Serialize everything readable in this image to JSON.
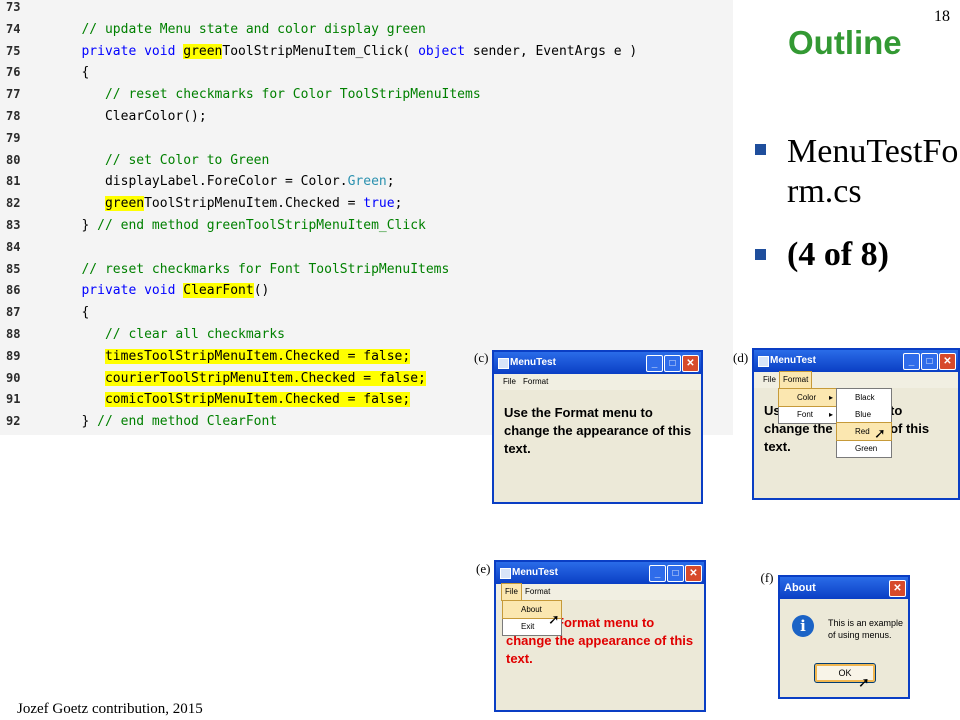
{
  "slide_number": "18",
  "outline_title": "Outline",
  "bullets": [
    "MenuTestForm.cs",
    "(4 of 8)"
  ],
  "footer": "Jozef Goetz contribution, 2015",
  "code_lines": [
    {
      "num": "73",
      "parts": []
    },
    {
      "num": "74",
      "parts": [
        {
          "t": "   "
        },
        {
          "t": "// update Menu state and color display green",
          "c": "cm"
        }
      ]
    },
    {
      "num": "75",
      "parts": [
        {
          "t": "   "
        },
        {
          "t": "private",
          "c": "kw"
        },
        {
          "t": " "
        },
        {
          "t": "void",
          "c": "kw"
        },
        {
          "t": " "
        },
        {
          "t": "green",
          "c": "hl"
        },
        {
          "t": "ToolStripMenuItem_Click( "
        },
        {
          "t": "object",
          "c": "kw"
        },
        {
          "t": " sender, EventArgs e )"
        }
      ]
    },
    {
      "num": "76",
      "parts": [
        {
          "t": "   {"
        }
      ]
    },
    {
      "num": "77",
      "parts": [
        {
          "t": "      "
        },
        {
          "t": "// reset checkmarks for Color ToolStripMenuItems",
          "c": "cm"
        }
      ]
    },
    {
      "num": "78",
      "parts": [
        {
          "t": "      ClearColor();"
        }
      ]
    },
    {
      "num": "79",
      "parts": []
    },
    {
      "num": "80",
      "parts": [
        {
          "t": "      "
        },
        {
          "t": "// set Color to Green",
          "c": "cm"
        }
      ]
    },
    {
      "num": "81",
      "parts": [
        {
          "t": "      displayLabel.ForeColor = Color."
        },
        {
          "t": "Green",
          "c": "ty"
        },
        {
          "t": ";"
        }
      ]
    },
    {
      "num": "82",
      "parts": [
        {
          "t": "      "
        },
        {
          "t": "green",
          "c": "hl"
        },
        {
          "t": "ToolStripMenuItem.Checked = "
        },
        {
          "t": "true",
          "c": "kw"
        },
        {
          "t": ";"
        }
      ]
    },
    {
      "num": "83",
      "parts": [
        {
          "t": "   } "
        },
        {
          "t": "// end method greenToolStripMenuItem_Click",
          "c": "cm"
        }
      ]
    },
    {
      "num": "84",
      "parts": []
    },
    {
      "num": "85",
      "parts": [
        {
          "t": "   "
        },
        {
          "t": "// reset checkmarks for Font ToolStripMenuItems",
          "c": "cm"
        }
      ]
    },
    {
      "num": "86",
      "parts": [
        {
          "t": "   "
        },
        {
          "t": "private",
          "c": "kw"
        },
        {
          "t": " "
        },
        {
          "t": "void",
          "c": "kw"
        },
        {
          "t": " "
        },
        {
          "t": "ClearFont",
          "c": "hl"
        },
        {
          "t": "()"
        }
      ]
    },
    {
      "num": "87",
      "parts": [
        {
          "t": "   {"
        }
      ]
    },
    {
      "num": "88",
      "parts": [
        {
          "t": "      "
        },
        {
          "t": "// clear all checkmarks",
          "c": "cm"
        }
      ]
    },
    {
      "num": "89",
      "parts": [
        {
          "t": "      "
        },
        {
          "t": "timesToolStripMenuItem.Checked = false;",
          "c": "hl"
        }
      ]
    },
    {
      "num": "90",
      "parts": [
        {
          "t": "      "
        },
        {
          "t": "courierToolStripMenuItem.Checked = false;",
          "c": "hl"
        }
      ]
    },
    {
      "num": "91",
      "parts": [
        {
          "t": "      "
        },
        {
          "t": "comicToolStripMenuItem.Checked = false;",
          "c": "hl"
        }
      ]
    },
    {
      "num": "92",
      "parts": [
        {
          "t": "   } "
        },
        {
          "t": "// end method ClearFont",
          "c": "cm"
        }
      ]
    }
  ],
  "captions": {
    "c": "(c)",
    "d": "(d)",
    "e": "(e)",
    "f": "(f)"
  },
  "window_c": {
    "title": "MenuTest",
    "menu": [
      "File",
      "Format"
    ],
    "text": "Use the Format menu to change the appearance of this text."
  },
  "window_d": {
    "title": "MenuTest",
    "menu": [
      "File",
      "Format"
    ],
    "text_l1": "Us",
    "text_l1b": "to",
    "text_l2": "change the",
    "text_l2b": "ce of this",
    "text_l3": "text.",
    "submenu": [
      "Color",
      "Font"
    ],
    "colors": [
      "Black",
      "Blue",
      "Red",
      "Green"
    ]
  },
  "window_e": {
    "title": "MenuTest",
    "menu": [
      "File",
      "Format"
    ],
    "file_items": [
      "About",
      "Exit"
    ],
    "text_l1": "Format menu to",
    "text_l2": "change the appearance of this",
    "text_l3": "text."
  },
  "window_f": {
    "title": "About",
    "message": "This is an example of using menus.",
    "ok": "OK"
  },
  "colors": {
    "outline": "#339933",
    "accent_red": "#e00000",
    "highlight": "#ffff00"
  }
}
